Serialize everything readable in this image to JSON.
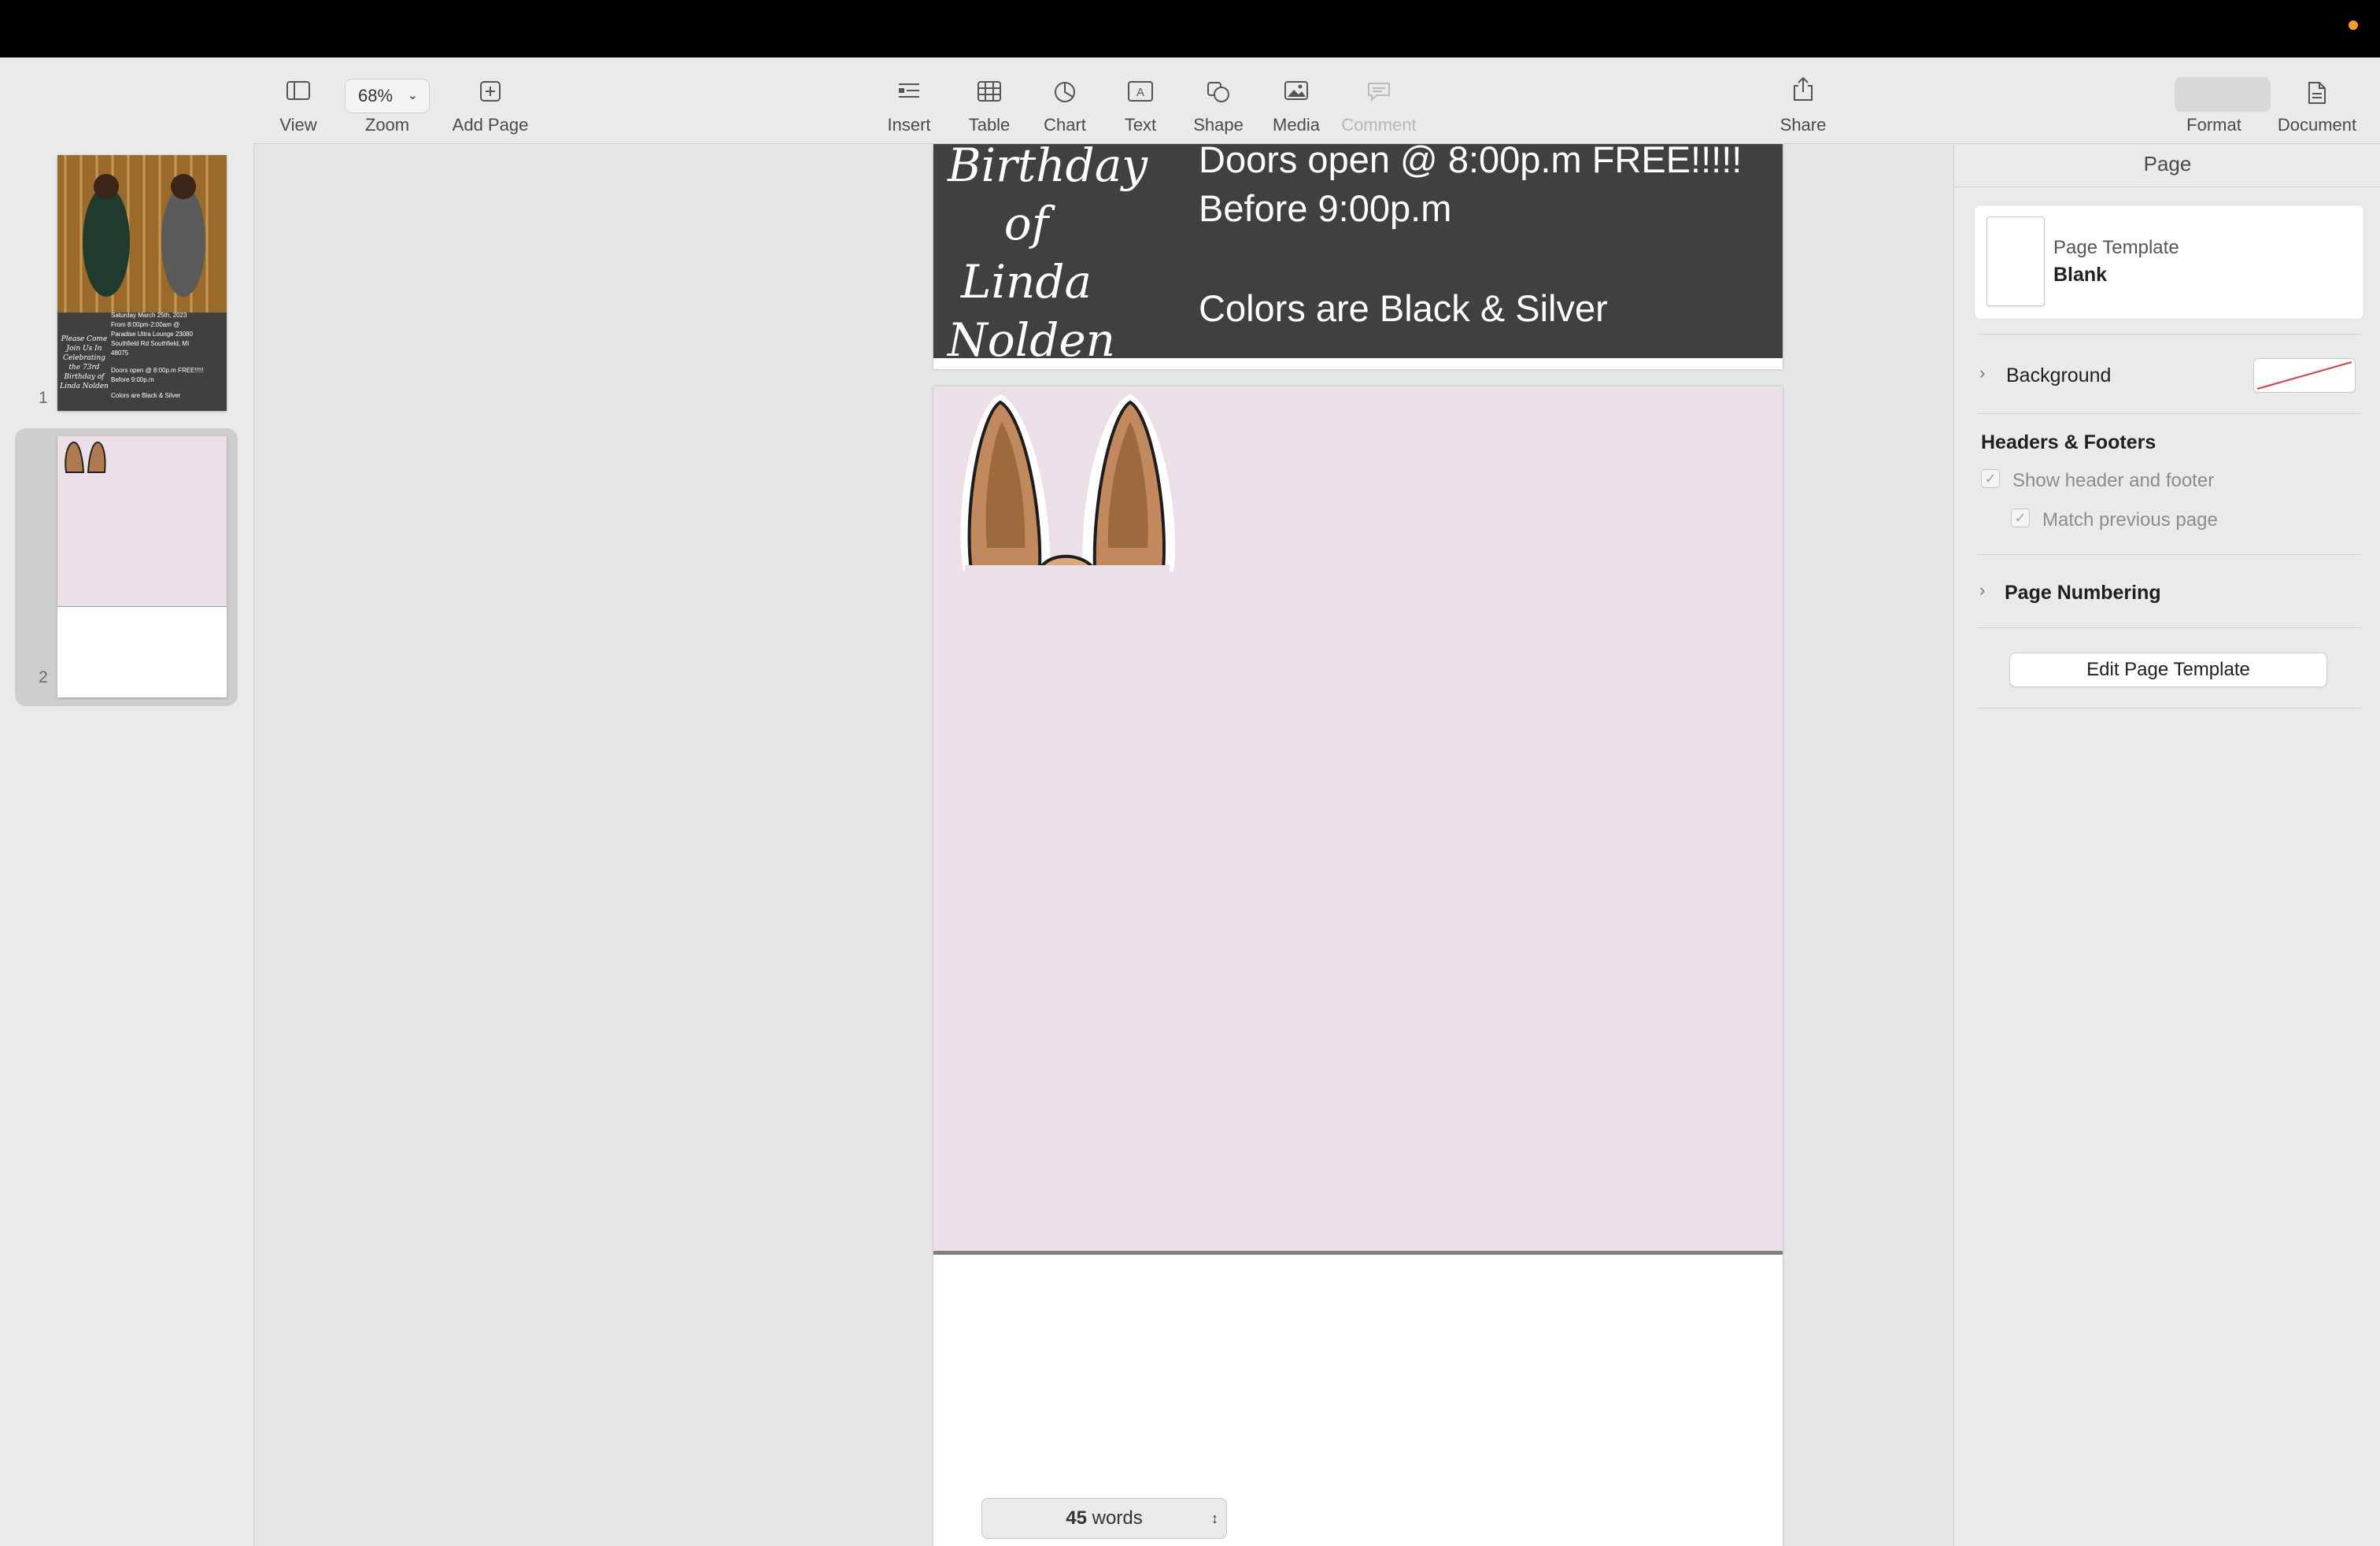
{
  "toolbar": {
    "view": "View",
    "zoom_value": "68%",
    "zoom": "Zoom",
    "add_page": "Add Page",
    "insert": "Insert",
    "table": "Table",
    "chart": "Chart",
    "text": "Text",
    "shape": "Shape",
    "media": "Media",
    "comment": "Comment",
    "share": "Share",
    "format": "Format",
    "document": "Document"
  },
  "sidebar": {
    "pages": [
      {
        "number": "1"
      },
      {
        "number": "2"
      }
    ],
    "thumb1_lines": [
      "Saturday March 25th, 2023",
      "From 8:00pm-2:00am @",
      "Paradise Ultra Lounge 23080",
      "Southfield Rd Southfield, MI",
      "48075",
      "Doors open @ 8:00p.m FREE!!!!!",
      "Before 9:00p.m",
      "Colors are Black & Silver"
    ],
    "thumb1_cursive": "Please Come Join Us In Celebrating the 73rd Birthday of Linda Nolden"
  },
  "document": {
    "cursive_lines": [
      "Birthday of",
      "Linda",
      "Nolden"
    ],
    "info_lines": [
      "Doors open @ 8:00p.m FREE!!!!!",
      "Before 9:00p.m",
      "Colors are Black & Silver"
    ]
  },
  "status": {
    "word_count": "45",
    "word_label": "words"
  },
  "inspector": {
    "title": "Page",
    "template_label": "Page Template",
    "template_value": "Blank",
    "background": "Background",
    "headers_footers": "Headers & Footers",
    "show_header_footer": "Show header and footer",
    "match_previous": "Match previous page",
    "page_numbering": "Page Numbering",
    "edit_template": "Edit Page Template"
  },
  "colors": {
    "flyer_bg": "#404040",
    "page_pink": "#ebe0e7",
    "ear_brown": "#b07a4e",
    "accent_orange": "#f5a020"
  }
}
